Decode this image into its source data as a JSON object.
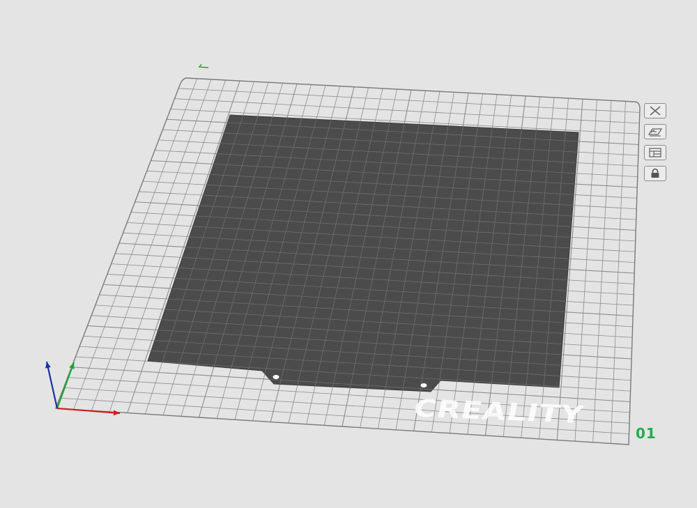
{
  "plate": {
    "index_label": "01",
    "index_color": "#1fae4f",
    "brand_text": "CREALITY"
  },
  "colors": {
    "background": "#e4e4e4",
    "bed_grid_line": "#8c8c8c",
    "bed_sheet": "#4a4b4a",
    "sheet_grid_line": "#6e706e",
    "axis_x": "#d11f1f",
    "axis_y": "#1fa43a",
    "axis_z": "#1c2fa8"
  },
  "tools": [
    {
      "name": "close-plate-icon",
      "tooltip": ""
    },
    {
      "name": "pick-plate-icon",
      "tooltip": ""
    },
    {
      "name": "arrange-plate-icon",
      "tooltip": ""
    },
    {
      "name": "lock-plate-icon",
      "tooltip": ""
    }
  ]
}
